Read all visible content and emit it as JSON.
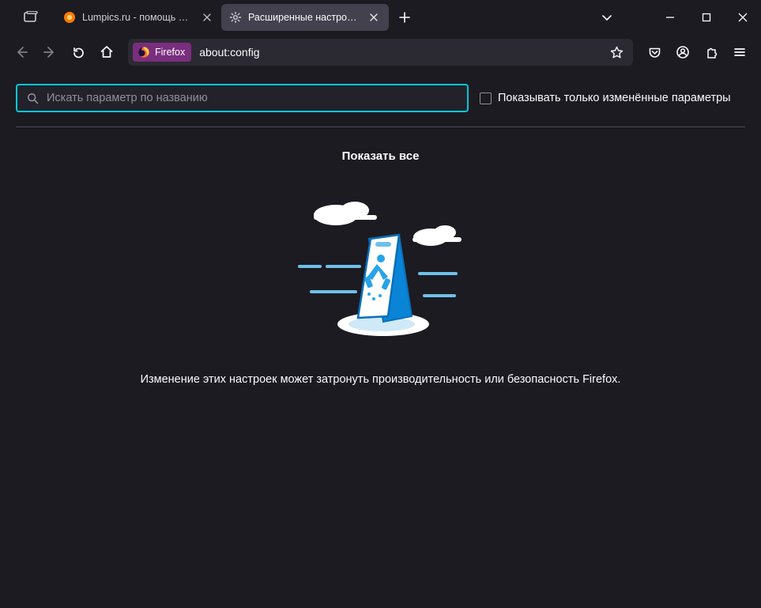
{
  "titlebar": {
    "tabs": [
      {
        "label": "Lumpics.ru - помощь с компь",
        "active": false
      },
      {
        "label": "Расширенные настройки",
        "active": true
      }
    ]
  },
  "urlbar": {
    "identity_label": "Firefox",
    "url": "about:config"
  },
  "config": {
    "search_placeholder": "Искать параметр по названию",
    "only_modified_label": "Показывать только изменённые параметры",
    "show_all": "Показать все",
    "warning": "Изменение этих настроек может затронуть производительность или безопасность Firefox."
  }
}
